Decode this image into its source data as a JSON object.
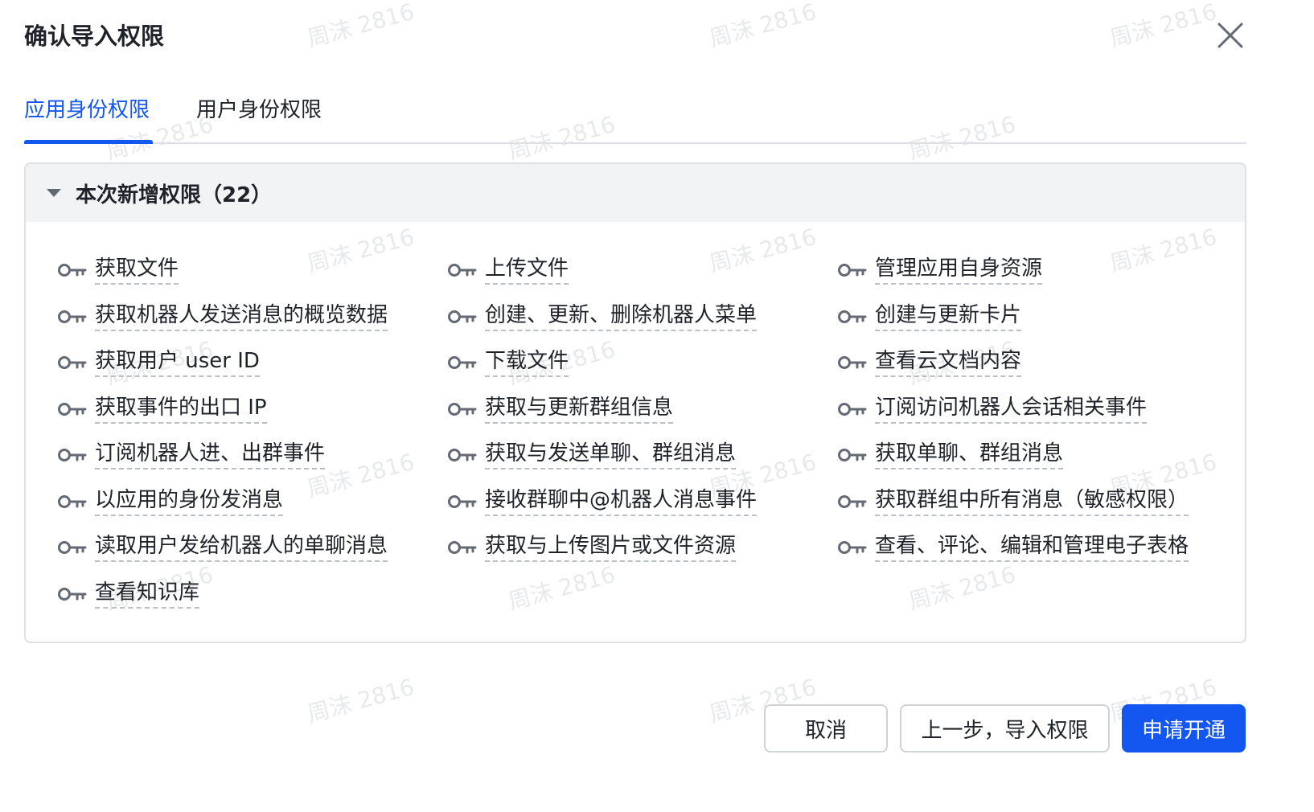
{
  "dialog": {
    "title": "确认导入权限"
  },
  "watermark": {
    "text": "周沫 2816"
  },
  "tabs": [
    {
      "label": "应用身份权限",
      "active": true
    },
    {
      "label": "用户身份权限",
      "active": false
    }
  ],
  "section": {
    "title": "本次新增权限（22）",
    "expanded": true
  },
  "permissions": {
    "col1": [
      "获取文件",
      "获取机器人发送消息的概览数据",
      "获取用户 user ID",
      "获取事件的出口 IP",
      "订阅机器人进、出群事件",
      "以应用的身份发消息",
      "读取用户发给机器人的单聊消息",
      "查看知识库"
    ],
    "col2": [
      "上传文件",
      "创建、更新、删除机器人菜单",
      "下载文件",
      "获取与更新群组信息",
      "获取与发送单聊、群组消息",
      "接收群聊中@机器人消息事件",
      "获取与上传图片或文件资源"
    ],
    "col3": [
      "管理应用自身资源",
      "创建与更新卡片",
      "查看云文档内容",
      "订阅访问机器人会话相关事件",
      "获取单聊、群组消息",
      "获取群组中所有消息（敏感权限）",
      "查看、评论、编辑和管理电子表格"
    ]
  },
  "footer": {
    "cancel_label": "取消",
    "prev_label": "上一步，导入权限",
    "submit_label": "申请开通"
  },
  "colors": {
    "primary": "#1456f0",
    "text": "#1f2329",
    "icon": "#646a73",
    "border": "#dee0e3",
    "header_bg": "#f2f3f5"
  }
}
